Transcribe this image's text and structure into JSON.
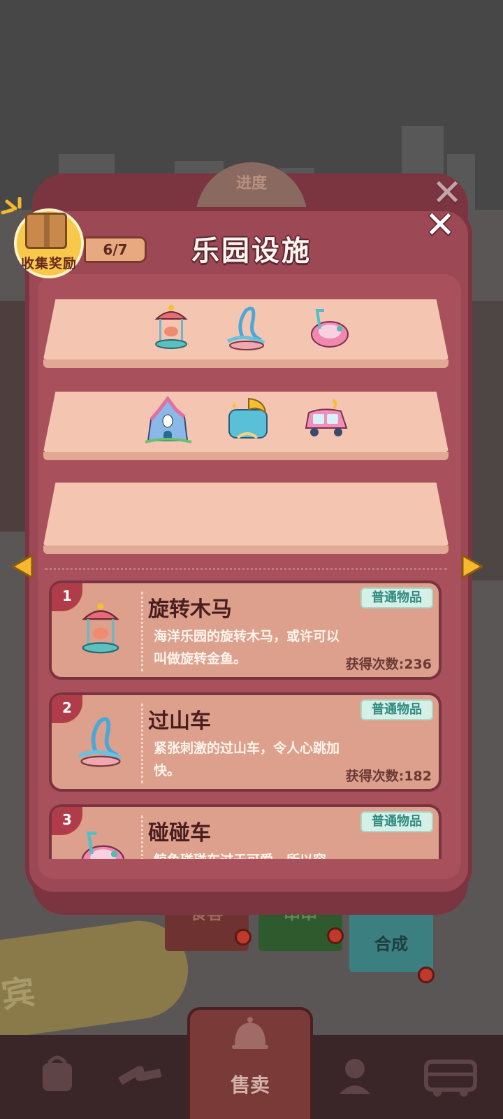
{
  "modal": {
    "title": "乐园设施",
    "progress_tab_label": "进度",
    "collection_reward_label": "收集奖励",
    "collection_count": "6/7"
  },
  "shelves": [
    {
      "items": [
        "carousel-icon",
        "roller-coaster-icon",
        "bumper-car-icon"
      ]
    },
    {
      "items": [
        "haunted-house-icon",
        "cake-house-icon",
        "pink-car-icon"
      ]
    },
    {
      "items": []
    }
  ],
  "items": [
    {
      "number": "1",
      "name": "旋转木马",
      "rarity": "普通物品",
      "description": "海洋乐园的旋转木马，或许可以叫做旋转金鱼。",
      "obtained": "获得次数:236"
    },
    {
      "number": "2",
      "name": "过山车",
      "rarity": "普通物品",
      "description": "紧张刺激的过山车，令人心跳加快。",
      "obtained": "获得次数:182"
    },
    {
      "number": "3",
      "name": "碰碰车",
      "rarity": "普通物品",
      "description": "鲸鱼碰碰车过于可爱，所以容",
      "obtained": ""
    }
  ],
  "background": {
    "banner_guest": "食客",
    "banner_skewer": "串串",
    "banner_merge": "合成",
    "yellow_text": "宾"
  },
  "bottom_nav": {
    "sell_label": "售卖"
  },
  "colors": {
    "modal": "#9c4855",
    "shelf": "#f4c6b2",
    "card": "#dca08c",
    "rarity_tag": "#d6f0e8",
    "arrow": "#f5b82e"
  }
}
